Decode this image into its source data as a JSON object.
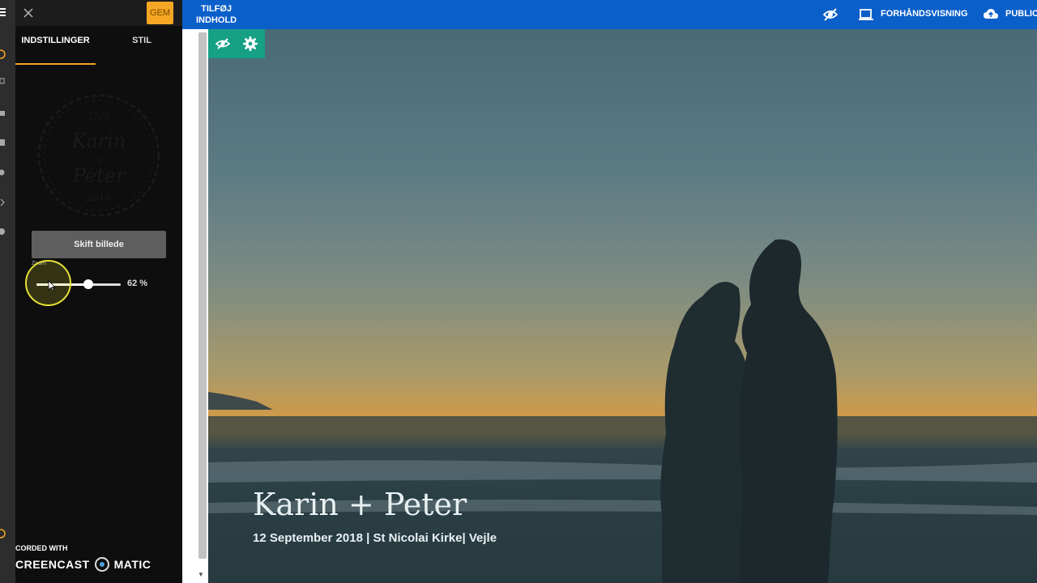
{
  "panel": {
    "save_label": "GEM",
    "tabs": [
      {
        "label": "INDSTILLINGER"
      },
      {
        "label": "STIL"
      }
    ],
    "logo": {
      "date": "15/9",
      "name1": "Karin",
      "plus": "+",
      "name2": "Peter",
      "year": "2018"
    },
    "swap_image_label": "Skift billede",
    "zoom_label": "Zoom",
    "zoom_value": 62,
    "zoom_value_text": "62 %"
  },
  "header": {
    "add_content_line1": "TILFØJ",
    "add_content_line2": "INDHOLD",
    "preview_label": "FORHÅNDSVISNING",
    "publish_label": "PUBLIC"
  },
  "hero": {
    "title": "Karin + Peter",
    "subtitle": "12 September 2018 | St Nicolai Kirke| Vejle"
  },
  "watermark": {
    "line1": "CORDED WITH",
    "line2a": "CREENCAST",
    "line2b": "MATIC"
  },
  "colors": {
    "header_blue": "#0b5fc9",
    "save_orange": "#f5a623",
    "hero_toolbar_teal": "#16a085",
    "panel_dark": "#0e0e0e"
  }
}
